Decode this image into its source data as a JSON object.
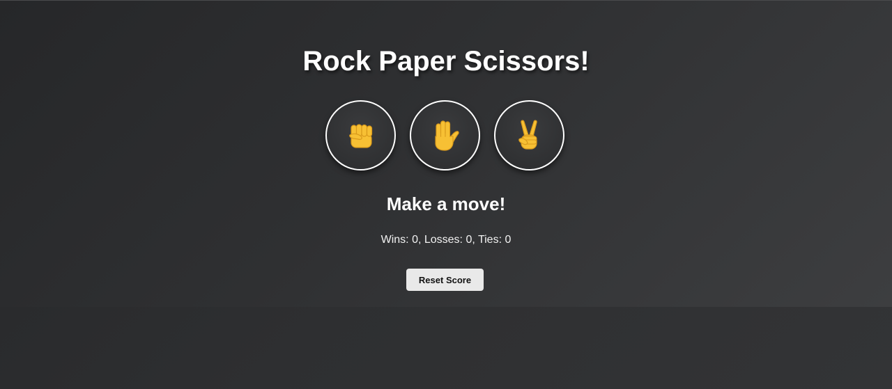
{
  "game": {
    "title": "Rock Paper Scissors!",
    "status": "Make a move!",
    "score_text": "Wins: 0, Losses: 0, Ties: 0",
    "reset_label": "Reset Score",
    "moves": [
      {
        "name": "rock",
        "icon": "raised-fist-icon"
      },
      {
        "name": "paper",
        "icon": "raised-hand-icon"
      },
      {
        "name": "scissors",
        "icon": "victory-hand-icon"
      }
    ]
  },
  "colors": {
    "icon_fill": "#F7C034",
    "icon_outline": "#D99A1C",
    "button_border": "#ffffff",
    "reset_background": "#e9e9e9"
  }
}
